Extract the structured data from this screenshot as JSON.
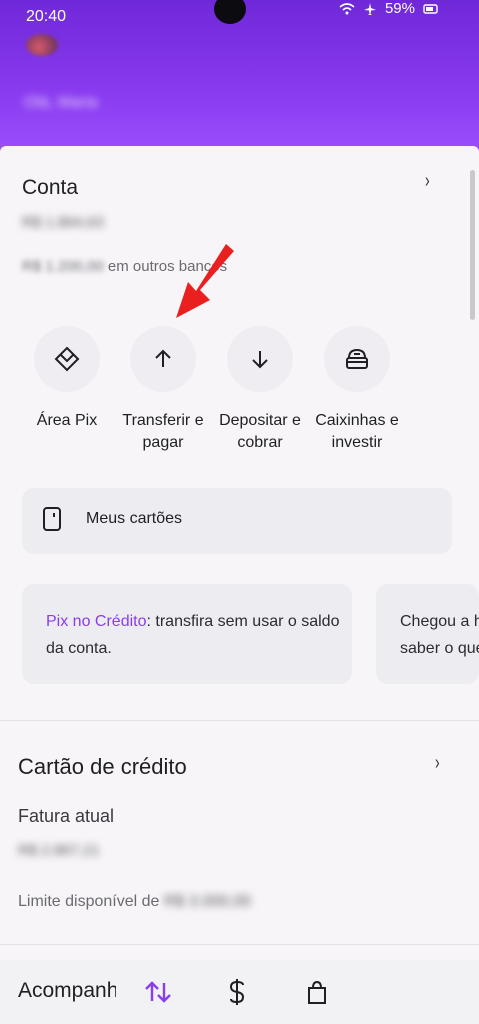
{
  "status_bar": {
    "time": "20:40",
    "battery": "59%"
  },
  "header": {
    "greeting": "Olá, Maria"
  },
  "conta": {
    "title": "Conta",
    "balance": "R$ 1.864,63",
    "other_banks_value": "R$ 1.200,00",
    "other_banks_text": "em outros bancos"
  },
  "actions": [
    {
      "icon": "pix-icon",
      "label": "Área Pix"
    },
    {
      "icon": "arrow-up-icon",
      "label": "Transferir e pagar"
    },
    {
      "icon": "arrow-down-icon",
      "label": "Depositar e cobrar"
    },
    {
      "icon": "piggy-box-icon",
      "label": "Caixinhas e investir"
    }
  ],
  "cards": {
    "label": "Meus cartões"
  },
  "promos": [
    {
      "highlight": "Pix no Crédito",
      "text": ": transfira sem usar o saldo da conta."
    },
    {
      "text": "Chegou a hora de saber o que fazer"
    }
  ],
  "credit_card": {
    "title": "Cartão de crédito",
    "fatura_label": "Fatura atual",
    "fatura_value": "R$ 2.867,21",
    "limite_label": "Limite disponível de",
    "limite_value": "R$ 3.000,00"
  },
  "bottom_nav": {
    "label": "Acompanhe",
    "accent": "#8a3cf0"
  }
}
